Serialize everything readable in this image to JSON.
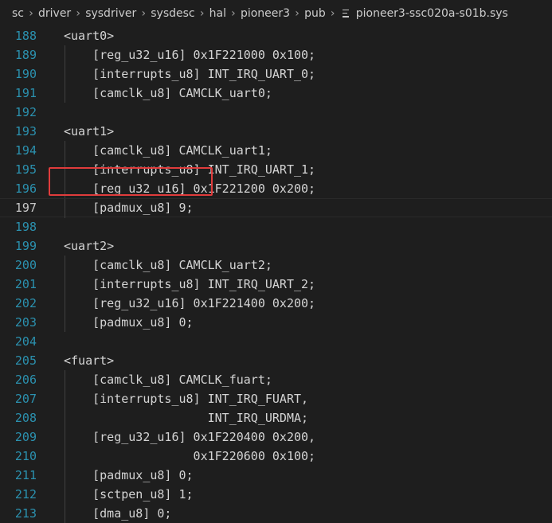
{
  "breadcrumb": {
    "items": [
      "sc",
      "driver",
      "sysdriver",
      "sysdesc",
      "hal",
      "pioneer3",
      "pub"
    ],
    "file": "pioneer3-ssc020a-s01b.sys",
    "separator": "›"
  },
  "editor": {
    "current_line": 197,
    "lines": [
      {
        "num": "188",
        "text": "<uart0>"
      },
      {
        "num": "189",
        "text": "    [reg_u32_u16] 0x1F221000 0x100;"
      },
      {
        "num": "190",
        "text": "    [interrupts_u8] INT_IRQ_UART_0;"
      },
      {
        "num": "191",
        "text": "    [camclk_u8] CAMCLK_uart0;"
      },
      {
        "num": "192",
        "text": ""
      },
      {
        "num": "193",
        "text": "<uart1>"
      },
      {
        "num": "194",
        "text": "    [camclk_u8] CAMCLK_uart1;"
      },
      {
        "num": "195",
        "text": "    [interrupts_u8] INT_IRQ_UART_1;"
      },
      {
        "num": "196",
        "text": "    [reg_u32_u16] 0x1F221200 0x200;"
      },
      {
        "num": "197",
        "text": "    [padmux_u8] 9;"
      },
      {
        "num": "198",
        "text": ""
      },
      {
        "num": "199",
        "text": "<uart2>"
      },
      {
        "num": "200",
        "text": "    [camclk_u8] CAMCLK_uart2;"
      },
      {
        "num": "201",
        "text": "    [interrupts_u8] INT_IRQ_UART_2;"
      },
      {
        "num": "202",
        "text": "    [reg_u32_u16] 0x1F221400 0x200;"
      },
      {
        "num": "203",
        "text": "    [padmux_u8] 0;"
      },
      {
        "num": "204",
        "text": ""
      },
      {
        "num": "205",
        "text": "<fuart>"
      },
      {
        "num": "206",
        "text": "    [camclk_u8] CAMCLK_fuart;"
      },
      {
        "num": "207",
        "text": "    [interrupts_u8] INT_IRQ_FUART,"
      },
      {
        "num": "208",
        "text": "                    INT_IRQ_URDMA;"
      },
      {
        "num": "209",
        "text": "    [reg_u32_u16] 0x1F220400 0x200,"
      },
      {
        "num": "210",
        "text": "                  0x1F220600 0x100;"
      },
      {
        "num": "211",
        "text": "    [padmux_u8] 0;"
      },
      {
        "num": "212",
        "text": "    [sctpen_u8] 1;"
      },
      {
        "num": "213",
        "text": "    [dma_u8] 0;"
      }
    ]
  }
}
